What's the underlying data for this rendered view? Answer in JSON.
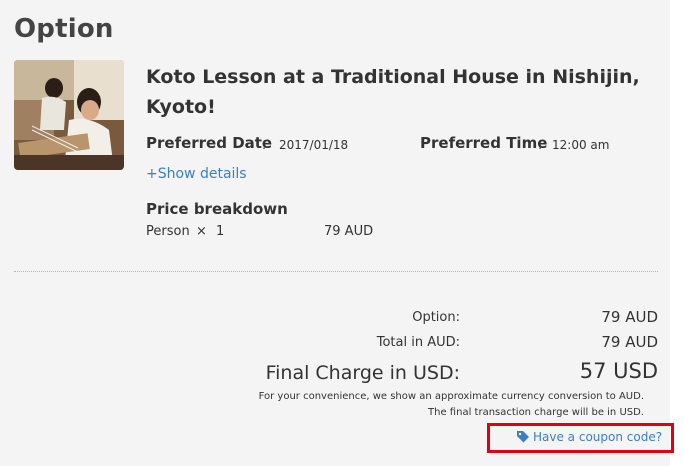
{
  "section": {
    "title": "Option"
  },
  "product": {
    "title_line1": "Koto Lesson at a Traditional House in Nishijin,",
    "title_line2": "Kyoto!",
    "image_icon": "photo-thumbnail"
  },
  "details": {
    "preferred_date_label": "Preferred Date",
    "preferred_date_sep": ":",
    "preferred_date_value": "2017/01/18",
    "preferred_time_label": "Preferred Time",
    "preferred_time_sep": ":",
    "preferred_time_value": "12:00 am",
    "show_details_label": "+Show details"
  },
  "price_breakdown": {
    "title": "Price breakdown",
    "item_label": "Person",
    "multiply_sign": "×",
    "quantity": "1",
    "amount": "79 AUD"
  },
  "summary": {
    "option_label": "Option:",
    "option_value": "79 AUD",
    "total_label": "Total in AUD:",
    "total_value": "79 AUD",
    "final_label": "Final Charge in USD:",
    "final_value": "57 USD",
    "note_line1": "For your convenience, we show an approximate currency conversion to AUD.",
    "note_line2": "The final transaction charge will be in USD."
  },
  "coupon": {
    "label": "Have a coupon code?",
    "icon": "tag-icon",
    "highlight_color": "#e0000f"
  },
  "colors": {
    "link": "#3a7fc1",
    "panel_bg": "#f4f4f4",
    "text": "#333333"
  }
}
